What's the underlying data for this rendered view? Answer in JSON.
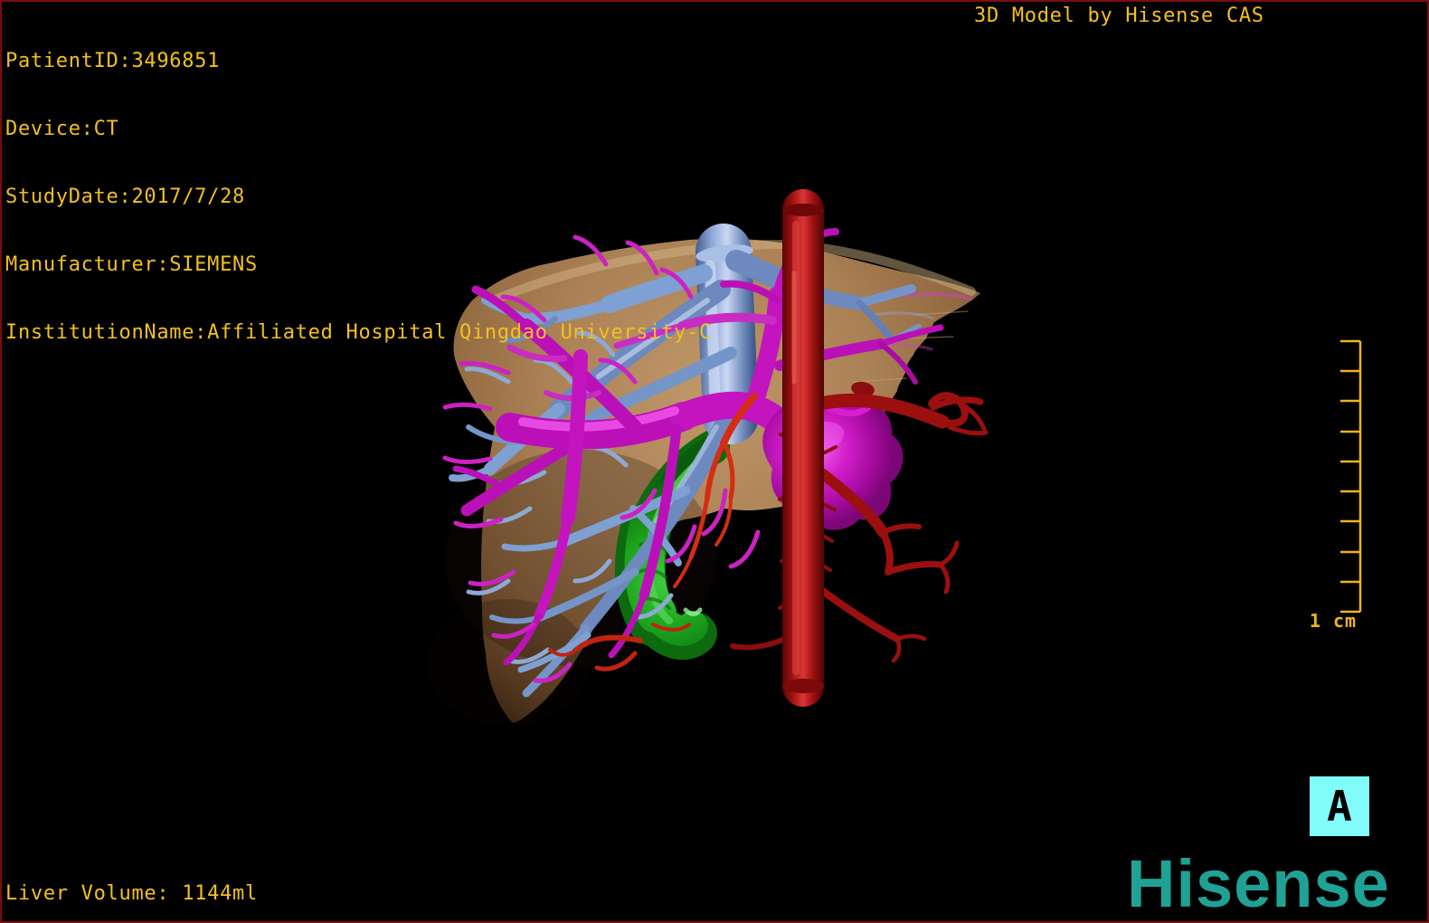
{
  "patient_info": {
    "lines": [
      "PatientID:3496851",
      "Device:CT",
      "StudyDate:2017/7/28",
      "Manufacturer:SIEMENS",
      "InstitutionName:Affiliated Hospital Qingdao University-C"
    ]
  },
  "header": {
    "watermark": "3D Model by Hisense CAS"
  },
  "footer": {
    "liver_volume": "Liver Volume: 1144ml",
    "brand_logo": "Hisense"
  },
  "scale_bar": {
    "label": "1 cm",
    "ticks": 10
  },
  "orientation_marker": {
    "label": "A"
  },
  "colors": {
    "annotation_text": "#f3c01f",
    "brand_teal": "#1fa295",
    "marker_background": "#82fbfb",
    "frame_border": "#7a0e0e",
    "liver": "#a87f54",
    "portal_vein_blue": "#7495c8",
    "hepatic_vein_magenta": "#bb10b8",
    "artery_red": "#a31010",
    "gallbladder_green": "#19ad19"
  }
}
